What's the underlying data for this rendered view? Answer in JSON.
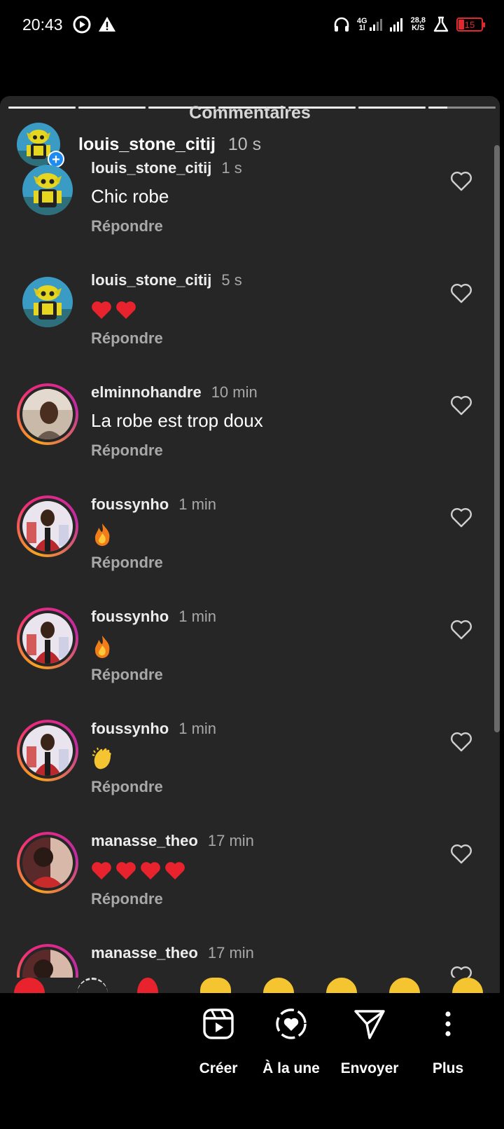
{
  "status_bar": {
    "time": "20:43",
    "network": "4G",
    "network_sub": "1l",
    "speed_value": "28,8",
    "speed_unit": "K/S",
    "battery": "15"
  },
  "sheet": {
    "title": "Commentaires",
    "story_progress_segments": 7,
    "story_user": "louis_stone_citij",
    "story_time": "10 s"
  },
  "comments": [
    {
      "user": "louis_stone_citij",
      "time": "1 s",
      "text": "Chic robe",
      "emojis": [],
      "reply": "Répondre",
      "avatar": "yellow-robot",
      "ring": false
    },
    {
      "user": "louis_stone_citij",
      "time": "5 s",
      "text": "",
      "emojis": [
        "red-heart",
        "red-heart"
      ],
      "reply": "Répondre",
      "avatar": "yellow-robot",
      "ring": false
    },
    {
      "user": "elminnohandre",
      "time": "10 min",
      "text": "La robe est trop doux",
      "emojis": [],
      "reply": "Répondre",
      "avatar": "man-selfie",
      "ring": true
    },
    {
      "user": "foussynho",
      "time": "1 min",
      "text": "",
      "emojis": [
        "fire"
      ],
      "reply": "Répondre",
      "avatar": "man-red-shirt",
      "ring": true
    },
    {
      "user": "foussynho",
      "time": "1 min",
      "text": "",
      "emojis": [
        "fire"
      ],
      "reply": "Répondre",
      "avatar": "man-red-shirt",
      "ring": true
    },
    {
      "user": "foussynho",
      "time": "1 min",
      "text": "",
      "emojis": [
        "clapping-hands"
      ],
      "reply": "Répondre",
      "avatar": "man-red-shirt",
      "ring": true
    },
    {
      "user": "manasse_theo",
      "time": "17 min",
      "text": "",
      "emojis": [
        "red-heart",
        "red-heart",
        "red-heart",
        "red-heart"
      ],
      "reply": "Répondre",
      "avatar": "man-profile",
      "ring": true
    },
    {
      "user": "manasse_theo",
      "time": "17 min",
      "text": "",
      "emojis": [],
      "reply": "",
      "avatar": "man-profile",
      "ring": true
    }
  ],
  "actions": [
    {
      "label": "Créer",
      "icon": "reels-create-icon"
    },
    {
      "label": "À la une",
      "icon": "highlight-heart-icon"
    },
    {
      "label": "Envoyer",
      "icon": "send-paper-plane-icon"
    },
    {
      "label": "Plus",
      "icon": "more-vertical-icon"
    }
  ],
  "colors": {
    "sheet_bg": "#262626",
    "story_ring_start": "#f8a51c",
    "story_ring_end": "#c02aa3",
    "plus_badge": "#1d8bf1",
    "battery_low": "#e0282e"
  }
}
